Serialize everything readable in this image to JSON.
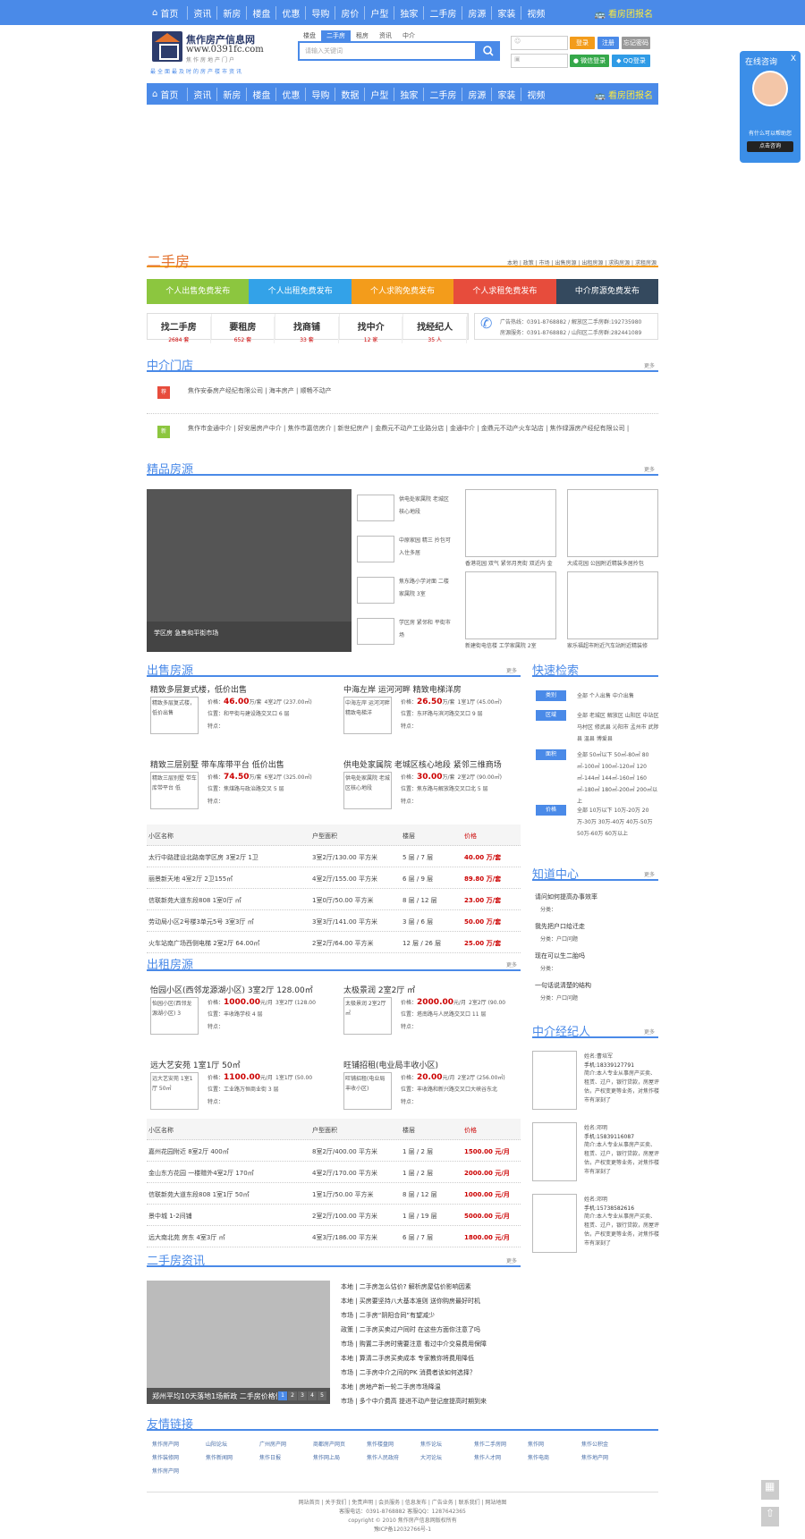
{
  "nav": {
    "home": "首页",
    "items": [
      "资讯",
      "新房",
      "楼盘",
      "优惠",
      "导购",
      "房价",
      "户型",
      "独家",
      "二手房",
      "房源",
      "家装",
      "视频"
    ],
    "cta": "看房团报名"
  },
  "nav2": {
    "home": "首页",
    "items": [
      "资讯",
      "新房",
      "楼盘",
      "优惠",
      "导购",
      "数据",
      "户型",
      "独家",
      "二手房",
      "房源",
      "家装",
      "视频"
    ],
    "cta": "看房团报名"
  },
  "logo": {
    "t1": "焦作房产信息网",
    "t2": "www.0391fc.com",
    "t3": "焦作房地产门户",
    "t4": "最全面最及时的房产楼市资讯"
  },
  "search": {
    "tabs": [
      "楼盘",
      "二手房",
      "租房",
      "资讯",
      "中介"
    ],
    "placeholder": "请输入关键词"
  },
  "login": {
    "login": "登录",
    "register": "注册",
    "forgot": "忘记密码",
    "wechat": "微信登录",
    "qq": "QQ登录"
  },
  "float": {
    "title": "在线咨询",
    "close": "X",
    "text": "有什么可以帮助您",
    "btn": "点击咨询"
  },
  "esf": {
    "title": "二手房",
    "links": "本地 | 政策 | 市场 | 出售房源 | 出租房源 | 求购房源 | 求租房源"
  },
  "publish": [
    "个人出售免费发布",
    "个人出租免费发布",
    "个人求购免费发布",
    "个人求租免费发布",
    "中介房源免费发布"
  ],
  "finds": [
    {
      "a": "找二手房",
      "b": "2684 套"
    },
    {
      "a": "要租房",
      "b": "652 套"
    },
    {
      "a": "找商铺",
      "b": "33 套"
    },
    {
      "a": "找中介",
      "b": "12 家"
    },
    {
      "a": "找经纪人",
      "b": "35 人"
    }
  ],
  "contact": {
    "l1": "广告热线：0391-8768882 / 解放区二手房群:192735980",
    "l2": "房源服务：0391-8768882 / 山阳区二手房群:282441089"
  },
  "agency": {
    "title": "中介门店",
    "more": "更多",
    "tag1": "荐",
    "row1": "焦作安泰房产经纪有限公司 | 海丰房产 | 顺畅不动产",
    "tag2": "新",
    "row2": "焦作市金通中介 | 好安居房产中介 | 焦作市嘉信房介 | 新世纪房产 | 金鼎元不动产工业路分店 | 金通中介 | 金鼎元不动产火车站店 | 焦作绿源房产经纪有限公司 |"
  },
  "jingpin": {
    "title": "精品房源",
    "more": "更多",
    "caption": "学区房 急售和平街市场",
    "thumbs": [
      "供电处家属院 老城区核心地段",
      "中原家园 精三 拎包可入住多居",
      "焦东路小学对面 二楼家属院 3室",
      "学区房 紧邻和 平街市场"
    ],
    "boxes": [
      "香港花园 双气 紧邻月亮街 双近内 金",
      "大成花园 公园附近精装多居拎包",
      "新建街电信楼 工学家属院 2室",
      "家乐福超市附近汽车站附近精装修"
    ]
  },
  "sale": {
    "title": "出售房源",
    "more": "更多",
    "cards": [
      {
        "title": "精致多层复式楼，低价出售",
        "img": "精致多层复式楼，低价出售",
        "price": "46.00",
        "unit": "万/套",
        "spec": "4室2厅 (237.00㎡)",
        "addr": "位置：和平街与建设路交叉口 6 层",
        "more": "特点："
      },
      {
        "title": "中海左岸 运河河畔 精致电梯洋房",
        "img": "中海左岸 运河河畔 精致电梯洋",
        "price": "26.50",
        "unit": "万/套",
        "spec": "1室1厅 (45.00㎡)",
        "addr": "位置：东环路与滨河路交叉口 9 层",
        "more": "特点："
      },
      {
        "title": "精致三层别墅 带车库带平台 低价出售",
        "img": "精致三层别墅 带车库带平台 低",
        "price": "74.50",
        "unit": "万/套",
        "spec": "6室2厅 (325.00㎡)",
        "addr": "位置：焦煤路与政治路交叉 5 层",
        "more": "特点："
      },
      {
        "title": "供电处家属院 老城区核心地段 紧邻三维商场",
        "img": "供电处家属院 老城区核心地段",
        "price": "30.00",
        "unit": "万/套",
        "spec": "2室2厅 (90.00㎡)",
        "addr": "位置：焦东路与解放路交叉口北 5 层",
        "more": "特点："
      }
    ],
    "cols": [
      "小区名称",
      "户型面积",
      "楼层",
      "价格"
    ],
    "rows": [
      [
        "太行中路建设北路南学区房 3室2厅 1卫",
        "3室2厅/130.00 平方米",
        "5 层 / 7 层",
        "40.00 万/套"
      ],
      [
        "丽景新天地 4室2厅 2卫155㎡",
        "4室2厅/155.00 平方米",
        "6 层 / 9 层",
        "89.80 万/套"
      ],
      [
        "信联新苑大道东段808 1室0厅 ㎡",
        "1室0厅/50.00 平方米",
        "8 层 / 12 层",
        "23.00 万/套"
      ],
      [
        "劳动局小区2号楼3单元5号 3室3厅 ㎡",
        "3室3厅/141.00 平方米",
        "3 层 / 6 层",
        "50.00 万/套"
      ],
      [
        "火车站南广场西侧电梯 2室2厅 64.00㎡",
        "2室2厅/64.00 平方米",
        "12 层 / 26 层",
        "25.00 万/套"
      ]
    ]
  },
  "rent": {
    "title": "出租房源",
    "more": "更多",
    "cards": [
      {
        "title": "怡园小区(西邻龙源湖小区) 3室2厅 128.00㎡",
        "img": "怡园小区(西邻龙源湖小区) 3",
        "price": "1000.00",
        "unit": "元/月",
        "spec": "3室2厅 (128.00",
        "addr": "位置：丰收路学校 4 层",
        "more": "特点："
      },
      {
        "title": "太极景润 2室2厅 ㎡",
        "img": "太极景润 2室2厅 ㎡",
        "price": "2000.00",
        "unit": "元/月",
        "spec": "2室2厅 (90.00",
        "addr": "位置：塔南路与人民路交叉口 11 层",
        "more": "特点："
      },
      {
        "title": "远大艺安苑 1室1厅 50㎡",
        "img": "远大艺安苑 1室1厅 50㎡",
        "price": "1100.00",
        "unit": "元/月",
        "spec": "1室1厅 (50.00",
        "addr": "位置：工业路万恒商业街 3 层",
        "more": "特点："
      },
      {
        "title": "旺铺招租(电业局丰收小区)",
        "img": "旺铺招租(电业局丰收小区)",
        "price": "20.00",
        "unit": "元/月",
        "spec": "2室2厅 (256.00㎡)",
        "addr": "位置：丰收路和新兴路交叉口大峡谷东北",
        "more": "特点："
      }
    ],
    "cols": [
      "小区名称",
      "户型面积",
      "楼层",
      "价格"
    ],
    "rows": [
      [
        "嘉州花园附近 8室2厅 400㎡",
        "8室2厅/400.00 平方米",
        "1 层 / 2 层",
        "1500.00 元/月"
      ],
      [
        "金山东方花园 一楼赠外4室2厅 170㎡",
        "4室2厅/170.00 平方米",
        "1 层 / 2 层",
        "2000.00 元/月"
      ],
      [
        "信联新苑大道东段808 1室1厅 50㎡",
        "1室1厅/50.00 平方米",
        "8 层 / 12 层",
        "1000.00 元/月"
      ],
      [
        "景中城 1-2间铺",
        "2室2厅/100.00 平方米",
        "1 层 / 19 层",
        "5000.00 元/月"
      ],
      [
        "远大南北苑 房东 4室3厅 ㎡",
        "4室3厅/186.00 平方米",
        "6 层 / 7 层",
        "1800.00 元/月"
      ]
    ]
  },
  "quick": {
    "title": "快速检索",
    "rows": [
      {
        "label": "类别",
        "value": "全部 个人出售 中介出售"
      },
      {
        "label": "区域",
        "value": "全部 老城区 解放区 山阳区 中站区 马村区 修武县 沁阳市 孟州市 武陟县 温县 博爱县"
      },
      {
        "label": "面积",
        "value": "全部 50㎡以下 50㎡-80㎡ 80㎡-100㎡ 100㎡-120㎡ 120㎡-144㎡ 144㎡-160㎡ 160㎡-180㎡ 180㎡-200㎡ 200㎡以上"
      },
      {
        "label": "价格",
        "value": "全部 10万以下 10万-20万 20万-30万 30万-40万 40万-50万 50万-60万 60万以上"
      }
    ]
  },
  "zhidao": {
    "title": "知道中心",
    "more": "更多",
    "items": [
      {
        "q": "请问如何提高办事效率",
        "c": "分类："
      },
      {
        "q": "我先把户口给迁走",
        "c": "分类：户口问题"
      },
      {
        "q": "现在可以生二胎吗",
        "c": "分类："
      },
      {
        "q": "一句话说清楚的结构",
        "c": "分类：户口问题"
      }
    ]
  },
  "agents": {
    "title": "中介经纪人",
    "more": "更多",
    "items": [
      {
        "name": "姓名:曹培军",
        "phone": "手机:18339127791",
        "intro": "简介:本人专业从事房产买卖、租赁、过户，银行贷款，房屋评估，产权变更等业务，对焦作楼市有深刻了"
      },
      {
        "name": "姓名:邓明",
        "phone": "手机:15839116087",
        "intro": "简介:本人专业从事房产买卖、租赁、过户，银行贷款，房屋评估，产权变更等业务，对焦作楼市有深刻了"
      },
      {
        "name": "姓名:邓明",
        "phone": "手机:15738582616",
        "intro": "简介:本人专业从事房产买卖、租赁、过户，银行贷款，房屋评估，产权变更等业务，对焦作楼市有深刻了"
      }
    ]
  },
  "news": {
    "title": "二手房资讯",
    "more": "更多",
    "caption": "郑州平均10天落地1场新政 二手房价格仍在下降",
    "pages": [
      "1",
      "2",
      "3",
      "4",
      "5"
    ],
    "items": [
      "本地 | 二手房怎么估价? 解析房屋估价影响因素",
      "本地 | 买房要坚持八大基本准则 送你购房最好时机",
      "市场 | 二手房“阴阳合同”有望减少",
      "政策 | 二手房买卖过户同时 在这些方面你注意了吗",
      "市场 | 购置二手房时需要注意 看过中介交易费用保障",
      "本地 | 算清二手房买卖成本 专家教你将费用降低",
      "市场 | 二手房中介之间的PK 消费者该如何选择？",
      "本地 | 房地产新一轮二手房市场降温",
      "市场 | 多个中介费高 提进不动产登记度提高时期到来"
    ]
  },
  "friends": {
    "title": "友情链接",
    "links": [
      "焦作房产网",
      "山阳论坛",
      "广州房产网",
      "商都房产网页",
      "焦作楼盘网",
      "焦作论坛",
      "焦作二手房网",
      "焦作网",
      "焦作公积金",
      "焦作装修网",
      "焦作新闻网",
      "焦作日报",
      "焦作网上局",
      "焦作人民政府",
      "大河论坛",
      "焦作人才网",
      "焦作电商",
      "焦作地产网",
      "焦作房产网"
    ]
  },
  "footer": {
    "l1": "网站首页 | 关于我们 | 免责声明 | 会员服务 | 信息发布 | 广告业务 | 联系我们 | 网站地图",
    "l2": "客服电话：0391-8768882  客服QQ：1287642365",
    "l3": "copyright © 2010 焦作房产信息网版权所有",
    "l4": "豫ICP备12032766号-1"
  },
  "colors": {
    "blue": "#4a8ae8",
    "green": "#8cc63f",
    "lightblue": "#33a2e8",
    "orange": "#f39c1b",
    "red": "#e74c3c",
    "dark": "#34495e"
  }
}
